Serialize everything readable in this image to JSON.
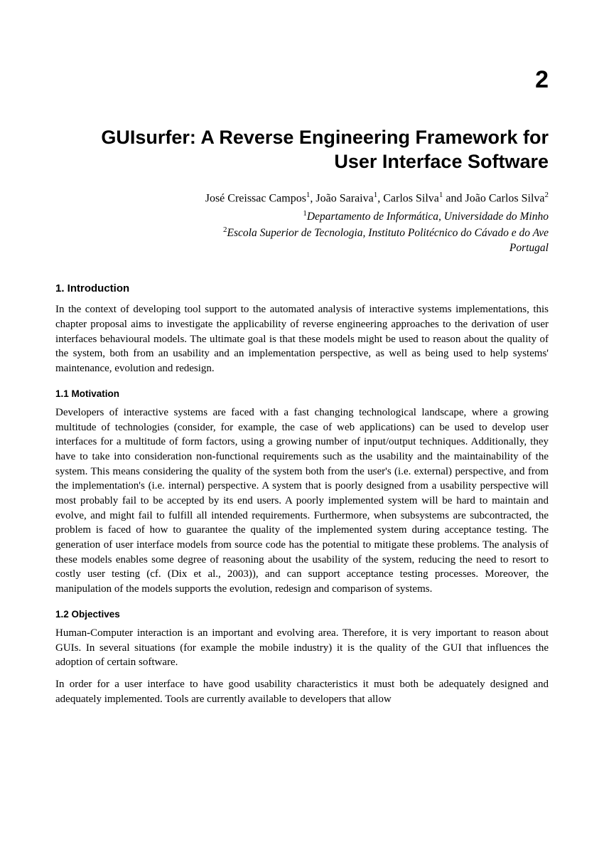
{
  "chapter_number": "2",
  "title": "GUIsurfer: A Reverse Engineering Framework for User Interface Software",
  "authors_html": "José Creissac Campos<sup>1</sup>, João Saraiva<sup>1</sup>, Carlos Silva<sup>1</sup> and João Carlos Silva<sup>2</sup>",
  "affil1_html": "<sup>1</sup>Departamento de Informática, Universidade do Minho",
  "affil2_html": "<sup>2</sup>Escola Superior de Tecnologia, Instituto Politécnico do Cávado e do Ave",
  "country": "Portugal",
  "sections": {
    "intro_heading": "1. Introduction",
    "intro_p1": "In the context of developing tool support to the automated analysis of interactive systems implementations, this chapter proposal aims to investigate the applicability of reverse engineering approaches to the derivation of user interfaces behavioural models. The ultimate goal is that these models might be used to reason about the quality of the system, both from an usability and an implementation perspective, as well as being used to help systems' maintenance, evolution and redesign.",
    "motivation_heading": "1.1 Motivation",
    "motivation_p1": "Developers of interactive systems are faced with a fast changing technological landscape, where a growing multitude of technologies (consider, for example, the case of web applications) can be used to develop user interfaces for a multitude of form factors, using a growing number of input/output techniques.  Additionally, they have to take into consideration non-functional requirements such as the usability and the maintainability of the system. This means considering the quality of the system both from the user's (i.e. external) perspective, and from the implementation's (i.e. internal) perspective. A system that is poorly designed from a usability perspective will most probably fail to be accepted by its end users. A poorly implemented system will be hard to maintain and evolve, and might fail to fulfill all intended requirements. Furthermore, when subsystems are subcontracted, the problem is faced of how to guarantee the quality of the implemented system during acceptance testing. The generation of user interface models from source code has the potential to mitigate these problems. The analysis of these models enables some degree of reasoning about the usability of the system, reducing the need to resort to costly user testing (cf. (Dix et al., 2003)), and can support acceptance testing processes. Moreover, the manipulation of the models supports the evolution, redesign and comparison of systems.",
    "objectives_heading": "1.2 Objectives",
    "objectives_p1": "Human-Computer interaction is an important and evolving area.  Therefore, it is very important to reason about GUIs. In several situations (for example the mobile industry) it is the quality of the GUI that influences the adoption of certain software.",
    "objectives_p2": "In order for a user interface to have good usability characteristics it must both be adequately designed and adequately implemented. Tools are currently available to developers that allow"
  }
}
